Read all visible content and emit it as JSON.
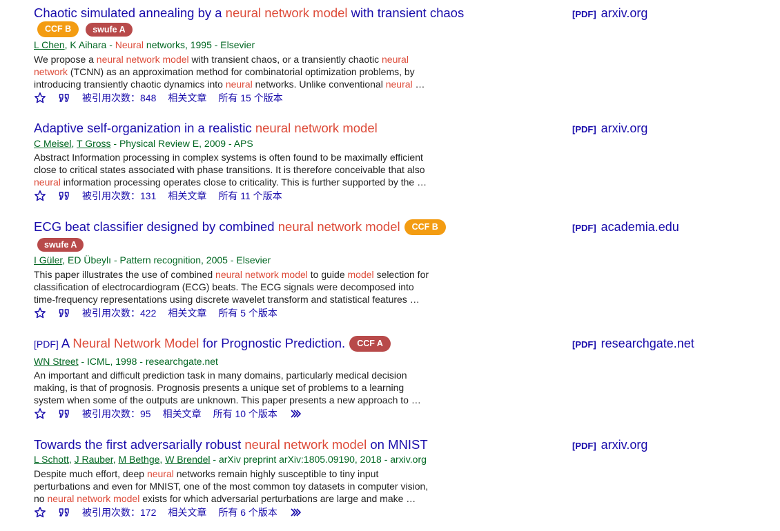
{
  "results": [
    {
      "title": [
        {
          "t": "Chaotic simulated annealing by a ",
          "h": false
        },
        {
          "t": "neural network model",
          "h": true
        },
        {
          "t": " with transient chaos",
          "h": false
        }
      ],
      "badges": [
        {
          "label": "CCF B",
          "style": "orange"
        },
        {
          "label": "swufe A",
          "style": "red"
        }
      ],
      "authors": [
        {
          "t": "L Chen",
          "u": true
        },
        {
          "t": ", K Aihara - ",
          "u": false
        },
        {
          "t": "Neural",
          "h": true
        },
        {
          "t": " networks, 1995 - Elsevier",
          "u": false
        }
      ],
      "snippet_lines": [
        [
          {
            "t": "We propose a "
          },
          {
            "t": "neural network model",
            "h": true
          },
          {
            "t": " with transient chaos, or a transiently chaotic "
          },
          {
            "t": "neural",
            "h": true
          }
        ],
        [
          {
            "t": "network",
            "h": true
          },
          {
            "t": " (TCNN) as an approximation method for combinatorial optimization problems, by"
          }
        ],
        [
          {
            "t": "introducing transiently chaotic dynamics into "
          },
          {
            "t": "neural",
            "h": true
          },
          {
            "t": " networks. Unlike conventional "
          },
          {
            "t": "neural",
            "h": true
          },
          {
            "t": " …"
          }
        ]
      ],
      "cited": "被引用次数：848",
      "related": "相关文章",
      "versions": "所有 15 个版本",
      "more": false,
      "side_pdf": "[PDF]",
      "side_source": "arxiv.org"
    },
    {
      "title": [
        {
          "t": "Adaptive self-organization in a realistic ",
          "h": false
        },
        {
          "t": "neural network model",
          "h": true
        }
      ],
      "badges": [],
      "authors": [
        {
          "t": "C Meisel",
          "u": true
        },
        {
          "t": ", ",
          "u": false
        },
        {
          "t": "T Gross",
          "u": true
        },
        {
          "t": " - Physical Review E, 2009 - APS",
          "u": false
        }
      ],
      "snippet_lines": [
        [
          {
            "t": "Abstract Information processing in complex systems is often found to be maximally efficient"
          }
        ],
        [
          {
            "t": "close to critical states associated with phase transitions. It is therefore conceivable that also"
          }
        ],
        [
          {
            "t": "neural",
            "h": true
          },
          {
            "t": " information processing operates close to criticality. This is further supported by the …"
          }
        ]
      ],
      "cited": "被引用次数：131",
      "related": "相关文章",
      "versions": "所有 11 个版本",
      "more": false,
      "side_pdf": "[PDF]",
      "side_source": "arxiv.org"
    },
    {
      "title": [
        {
          "t": "ECG beat classifier designed by combined ",
          "h": false
        },
        {
          "t": "neural network model",
          "h": true
        }
      ],
      "inline_badge": {
        "label": "CCF B",
        "style": "orange"
      },
      "badges": [
        {
          "label": "swufe A",
          "style": "red"
        }
      ],
      "authors": [
        {
          "t": "I Güler",
          "u": true
        },
        {
          "t": ", ED Übeylı - Pattern recognition, 2005 - Elsevier",
          "u": false
        }
      ],
      "snippet_lines": [
        [
          {
            "t": "This paper illustrates the use of combined "
          },
          {
            "t": "neural network model",
            "h": true
          },
          {
            "t": " to guide "
          },
          {
            "t": "model",
            "h": true
          },
          {
            "t": " selection for"
          }
        ],
        [
          {
            "t": "classification of electrocardiogram (ECG) beats. The ECG signals were decomposed into"
          }
        ],
        [
          {
            "t": "time-frequency representations using discrete wavelet transform and statistical features …"
          }
        ]
      ],
      "cited": "被引用次数：422",
      "related": "相关文章",
      "versions": "所有 5 个版本",
      "more": false,
      "side_pdf": "[PDF]",
      "side_source": "academia.edu"
    },
    {
      "pdf_prefix": "[PDF]",
      "title": [
        {
          "t": " A ",
          "h": false
        },
        {
          "t": "Neural Network Model",
          "h": true
        },
        {
          "t": " for Prognostic Prediction.",
          "h": false
        }
      ],
      "inline_badge": {
        "label": "CCF A",
        "style": "red-big"
      },
      "badges": [],
      "authors": [
        {
          "t": "WN Street",
          "u": true
        },
        {
          "t": " - ICML, 1998 - researchgate.net",
          "u": false
        }
      ],
      "snippet_lines": [
        [
          {
            "t": "An important and difficult prediction task in many domains, particularly medical decision"
          }
        ],
        [
          {
            "t": "making, is that of prognosis. Prognosis presents a unique set of problems to a learning"
          }
        ],
        [
          {
            "t": "system when some of the outputs are unknown. This paper presents a new approach to …"
          }
        ]
      ],
      "cited": "被引用次数：95",
      "related": "相关文章",
      "versions": "所有 10 个版本",
      "more": true,
      "side_pdf": "[PDF]",
      "side_source": "researchgate.net"
    },
    {
      "title": [
        {
          "t": "Towards the first adversarially robust ",
          "h": false
        },
        {
          "t": "neural network model",
          "h": true
        },
        {
          "t": " on MNIST",
          "h": false
        }
      ],
      "badges": [],
      "authors": [
        {
          "t": "L Schott",
          "u": true
        },
        {
          "t": ", ",
          "u": false
        },
        {
          "t": "J Rauber",
          "u": true
        },
        {
          "t": ", ",
          "u": false
        },
        {
          "t": "M Bethge",
          "u": true
        },
        {
          "t": ", ",
          "u": false
        },
        {
          "t": "W Brendel",
          "u": true
        },
        {
          "t": " - arXiv preprint arXiv:1805.09190, 2018 - arxiv.org",
          "u": false
        }
      ],
      "snippet_lines": [
        [
          {
            "t": "Despite much effort, deep "
          },
          {
            "t": "neural",
            "h": true
          },
          {
            "t": " networks remain highly susceptible to tiny input"
          }
        ],
        [
          {
            "t": "perturbations and even for MNIST, one of the most common toy datasets in computer vision,"
          }
        ],
        [
          {
            "t": "no "
          },
          {
            "t": "neural network model",
            "h": true
          },
          {
            "t": " exists for which adversarial perturbations are large and make …"
          }
        ]
      ],
      "cited": "被引用次数：172",
      "related": "相关文章",
      "versions": "所有 6 个版本",
      "more": true,
      "side_pdf": "[PDF]",
      "side_source": "arxiv.org"
    }
  ]
}
